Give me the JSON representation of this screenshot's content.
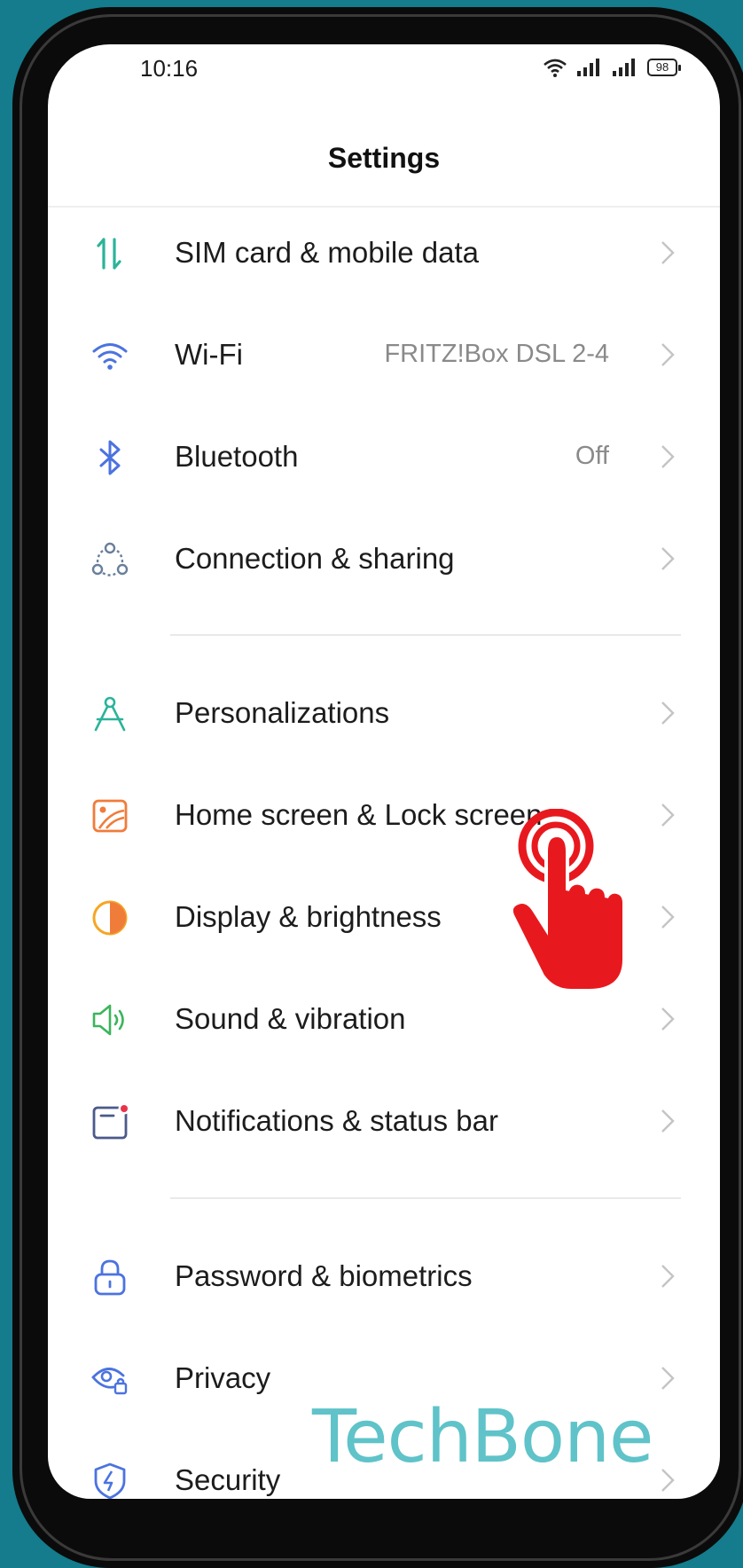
{
  "status_bar": {
    "time": "10:16",
    "battery": "98"
  },
  "header": {
    "title": "Settings"
  },
  "groups": [
    {
      "items": [
        {
          "label": "SIM card & mobile data",
          "value": "",
          "icon": "mobile-data-icon",
          "color": "#2bb39a"
        },
        {
          "label": "Wi-Fi",
          "value": "FRITZ!Box DSL 2-4",
          "icon": "wifi-icon",
          "color": "#4b73e0"
        },
        {
          "label": "Bluetooth",
          "value": "Off",
          "icon": "bluetooth-icon",
          "color": "#4b73e0"
        },
        {
          "label": "Connection & sharing",
          "value": "",
          "icon": "connection-sharing-icon",
          "color": "#6a7f9a"
        }
      ]
    },
    {
      "items": [
        {
          "label": "Personalizations",
          "value": "",
          "icon": "compass-icon",
          "color": "#2bb39a"
        },
        {
          "label": "Home screen & Lock screen",
          "value": "",
          "icon": "wallpaper-icon",
          "color": "#f07c3a"
        },
        {
          "label": "Display & brightness",
          "value": "",
          "icon": "brightness-icon",
          "color": "#f5a623"
        },
        {
          "label": "Sound & vibration",
          "value": "",
          "icon": "speaker-icon",
          "color": "#3bb55b"
        },
        {
          "label": "Notifications & status bar",
          "value": "",
          "icon": "notification-icon",
          "color": "#4a5a8a"
        }
      ]
    },
    {
      "items": [
        {
          "label": "Password & biometrics",
          "value": "",
          "icon": "lock-icon",
          "color": "#4b73e0"
        },
        {
          "label": "Privacy",
          "value": "",
          "icon": "privacy-icon",
          "color": "#4b73e0"
        },
        {
          "label": "Security",
          "value": "",
          "icon": "shield-icon",
          "color": "#4b73e0"
        }
      ]
    }
  ],
  "watermark": {
    "text": "TechBone",
    "color": "#5fc3c9"
  },
  "tap_indicator": {
    "icon": "tap-hand-icon",
    "color": "#e8191e"
  }
}
